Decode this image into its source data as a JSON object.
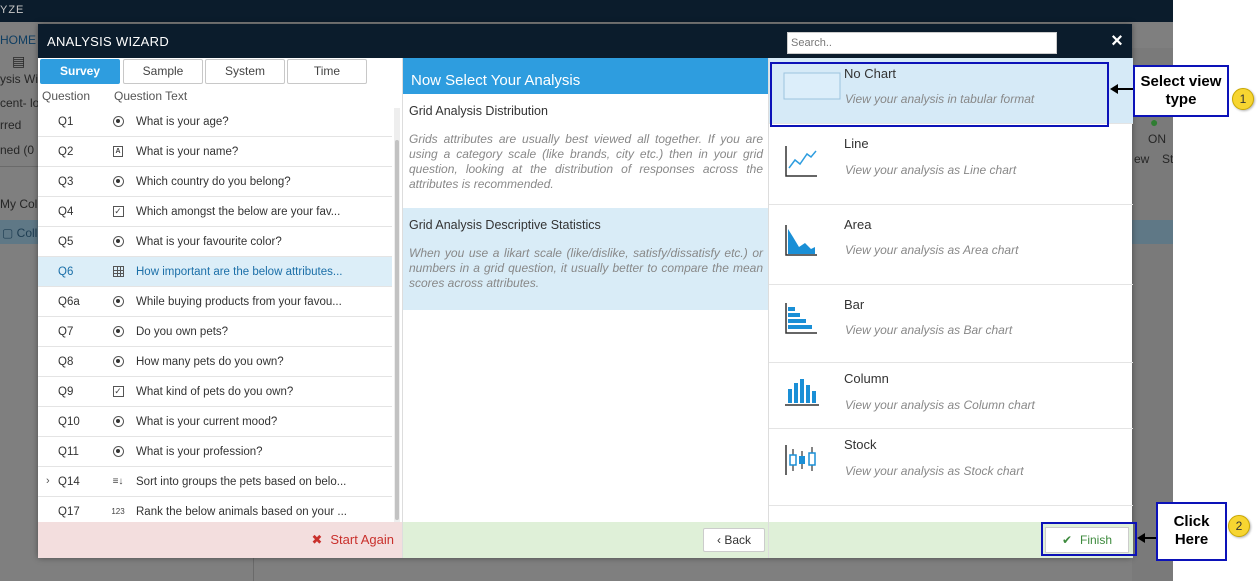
{
  "background": {
    "brand": "YZE",
    "home": "HOME",
    "texts": [
      "ysis Wi",
      "cent- lo",
      "rred",
      "ned (0",
      "My Coll",
      "Coll"
    ],
    "right_on": "ON",
    "right_texts": [
      "ew",
      "St"
    ]
  },
  "modal": {
    "title": "ANALYSIS WIZARD",
    "search_placeholder": "Search..",
    "close_symbol": "×"
  },
  "tabs": [
    {
      "label": "Survey",
      "active": true
    },
    {
      "label": "Sample",
      "active": false
    },
    {
      "label": "System",
      "active": false
    },
    {
      "label": "Time",
      "active": false
    }
  ],
  "columns": {
    "question": "Question",
    "question_text": "Question Text"
  },
  "questions": [
    {
      "id": "Q1",
      "type": "radio-icon",
      "text": "What is your age?"
    },
    {
      "id": "Q2",
      "type": "text-icon",
      "text": "What is your name?"
    },
    {
      "id": "Q3",
      "type": "radio-icon",
      "text": "Which country do you belong?"
    },
    {
      "id": "Q4",
      "type": "checkbox-icon",
      "text": "Which amongst the below are your fav..."
    },
    {
      "id": "Q5",
      "type": "radio-icon",
      "text": "What is your favourite color?"
    },
    {
      "id": "Q6",
      "type": "grid-icon",
      "text": "How important are the below attributes...",
      "selected": true
    },
    {
      "id": "Q6a",
      "type": "radio-icon",
      "text": "While buying products from your favou..."
    },
    {
      "id": "Q7",
      "type": "radio-icon",
      "text": "Do you own pets?"
    },
    {
      "id": "Q8",
      "type": "radio-icon",
      "text": "How many pets do you own?"
    },
    {
      "id": "Q9",
      "type": "checkbox-icon",
      "text": "What kind of pets do you own?"
    },
    {
      "id": "Q10",
      "type": "radio-icon",
      "text": "What is your current mood?"
    },
    {
      "id": "Q11",
      "type": "radio-icon",
      "text": "What is your profession?"
    },
    {
      "id": "Q14",
      "type": "sort-icon",
      "text": "Sort into groups the pets based on belo...",
      "expandable": true
    },
    {
      "id": "Q17",
      "type": "rank-icon",
      "text": "Rank the below animals based on your ..."
    }
  ],
  "start_again": {
    "symbol": "✖",
    "label": "Start Again"
  },
  "middle": {
    "header": "Now Select Your Analysis",
    "analyses": [
      {
        "title": "Grid Analysis Distribution",
        "description": "Grids attributes are usually best viewed all together. If you are using a category scale (like brands, city etc.) then in your grid question, looking at the distribution of responses across the attributes is recommended.",
        "selected": false
      },
      {
        "title": "Grid Analysis Descriptive Statistics",
        "description": "When you use a likart scale (like/dislike, satisfy/dissatisfy etc.) or numbers in a grid question, it usually better to compare the mean scores across attributes.",
        "selected": true
      }
    ],
    "back_label": "‹ Back"
  },
  "view_types": [
    {
      "name": "No Chart",
      "description": "View your analysis in tabular format",
      "icon": "table-icon",
      "selected": true
    },
    {
      "name": "Line",
      "description": "View your analysis as Line chart",
      "icon": "line-chart-icon"
    },
    {
      "name": "Area",
      "description": "View your analysis as Area chart",
      "icon": "area-chart-icon"
    },
    {
      "name": "Bar",
      "description": "View your analysis as Bar chart",
      "icon": "bar-chart-icon"
    },
    {
      "name": "Column",
      "description": "View your analysis as Column chart",
      "icon": "column-chart-icon"
    },
    {
      "name": "Stock",
      "description": "View your analysis as Stock chart",
      "icon": "stock-chart-icon"
    }
  ],
  "finish": {
    "symbol": "✔",
    "label": "Finish"
  },
  "annotations": [
    {
      "text": "Select view type",
      "badge": "1"
    },
    {
      "text": "Click Here",
      "badge": "2"
    }
  ],
  "colors": {
    "header_bg": "#0b1c2c",
    "accent_blue": "#2e9ddf",
    "selected_bg": "#d6eaf7",
    "annotation_border": "#0c12b8",
    "badge_yellow": "#f7d531"
  }
}
